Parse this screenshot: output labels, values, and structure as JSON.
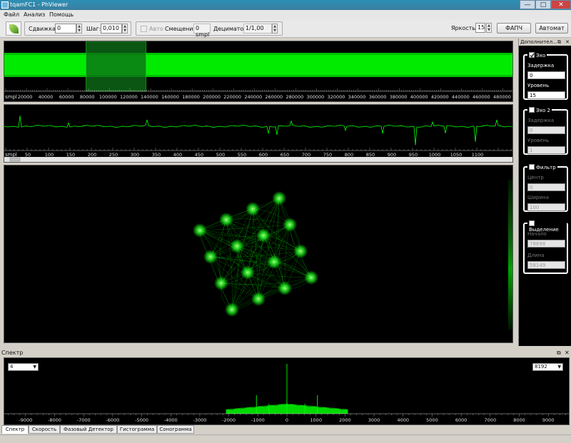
{
  "window": {
    "title": "tqamFC1 - PhViewer",
    "minimize": "—",
    "maximize": "□",
    "close": "✕"
  },
  "menu": [
    "Файл",
    "Анализ",
    "Помощь"
  ],
  "toolbar": {
    "shift_label": "Сдвижка:",
    "shift_value": "0",
    "step_label": "Шаг:",
    "step_value": "0,010",
    "auto_label": "Авто",
    "auto_checked": false,
    "offset_label": "Смещение:",
    "offset_value": "0 smpl",
    "decimator_label": "Дециматор:",
    "decimator_value": "1/1,00",
    "brightness_label": "Яркость:",
    "brightness_value": "15",
    "fapch_label": "ФАПЧ",
    "automat_label": "Автомат"
  },
  "overview": {
    "axis_unit": "smpl",
    "ticks": [
      "20000",
      "40000",
      "60000",
      "80000",
      "100000",
      "120000",
      "140000",
      "160000",
      "180000",
      "200000",
      "220000",
      "240000",
      "260000",
      "280000",
      "300000",
      "320000",
      "340000",
      "360000",
      "380000",
      "400000",
      "420000",
      "440000",
      "460000",
      "480000"
    ],
    "selection_start": 78698,
    "selection_length": 58149,
    "total_samples": 490000
  },
  "waveform": {
    "axis_unit": "smpl",
    "ticks": [
      "50",
      "100",
      "150",
      "200",
      "250",
      "300",
      "350",
      "400",
      "450",
      "500",
      "550",
      "600",
      "650",
      "700",
      "750",
      "800",
      "850",
      "900",
      "950",
      "1000",
      "1050",
      "1100"
    ]
  },
  "constellation": {
    "grid": 4
  },
  "dock": {
    "title": "Дополнител...",
    "echo": {
      "title": "Эхо",
      "checked": true,
      "delay_label": "Задержка",
      "delay_value": "0",
      "level_label": "Уровень",
      "level_value": "15"
    },
    "echo2": {
      "title": "Эхо 2",
      "checked": false,
      "delay_label": "Задержка",
      "delay_value": "0",
      "level_label": "Уровень",
      "level_value": "1"
    },
    "filter": {
      "title": "Фильтр",
      "checked": false,
      "center_label": "Центр",
      "center_value": "0",
      "width_label": "Ширина",
      "width_value": "100"
    },
    "selection": {
      "title": "Выделение",
      "checked": false,
      "start_label": "Начало",
      "start_value": "78698",
      "length_label": "Длина",
      "length_value": "58149"
    }
  },
  "spectrum": {
    "title": "Спектр",
    "left_combo": "4",
    "right_combo": "8192",
    "ticks": [
      "-9000",
      "-8000",
      "-7000",
      "-6000",
      "-5000",
      "-4000",
      "-3000",
      "-2000",
      "-1000",
      "0",
      "1000",
      "2000",
      "3000",
      "4000",
      "5000",
      "6000",
      "7000",
      "8000",
      "9000"
    ]
  },
  "tabs": [
    "Спектр",
    "Скорость",
    "Фазовый Детектор",
    "Гистограмма",
    "Сонограмма"
  ],
  "colors": {
    "signal": "#00ff00",
    "background": "#000000"
  }
}
